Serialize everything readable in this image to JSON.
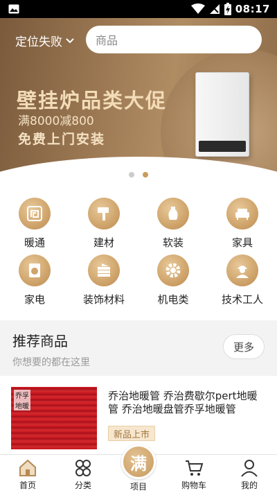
{
  "status_bar": {
    "time": "08:17"
  },
  "header": {
    "location_label": "定位失败",
    "search_placeholder": "商品"
  },
  "banner": {
    "headline": "壁挂炉品类大促",
    "promo": "满8000减800",
    "install": "免费上门安装",
    "slide_count": 2,
    "active_slide": 2
  },
  "categories": [
    {
      "label": "暖通",
      "icon": "heating-icon"
    },
    {
      "label": "建材",
      "icon": "paint-brush-icon"
    },
    {
      "label": "软装",
      "icon": "vase-icon"
    },
    {
      "label": "家具",
      "icon": "sofa-icon"
    },
    {
      "label": "家电",
      "icon": "washing-machine-icon"
    },
    {
      "label": "装饰材料",
      "icon": "tiles-icon"
    },
    {
      "label": "机电类",
      "icon": "gear-icon"
    },
    {
      "label": "技术工人",
      "icon": "worker-icon"
    }
  ],
  "recommend": {
    "title": "推荐商品",
    "subtitle": "你想要的都在这里",
    "more_label": "更多"
  },
  "products": [
    {
      "name": "乔治地暖管 乔治费歇尔pert地暖管 乔治地暖盘管乔孚地暖管",
      "badge": "新品上市",
      "thumb_text": "乔孚\n地暖"
    }
  ],
  "tabbar": {
    "items": [
      {
        "label": "首页",
        "icon": "home-icon"
      },
      {
        "label": "分类",
        "icon": "category-icon"
      },
      {
        "label": "项目",
        "icon": "project-icon"
      },
      {
        "label": "购物车",
        "icon": "cart-icon"
      },
      {
        "label": "我的",
        "icon": "user-icon"
      }
    ],
    "center_label": "满"
  },
  "colors": {
    "accent": "#c89b5e",
    "badge_bg": "#f7e7cf",
    "status_bar": "#000000"
  }
}
